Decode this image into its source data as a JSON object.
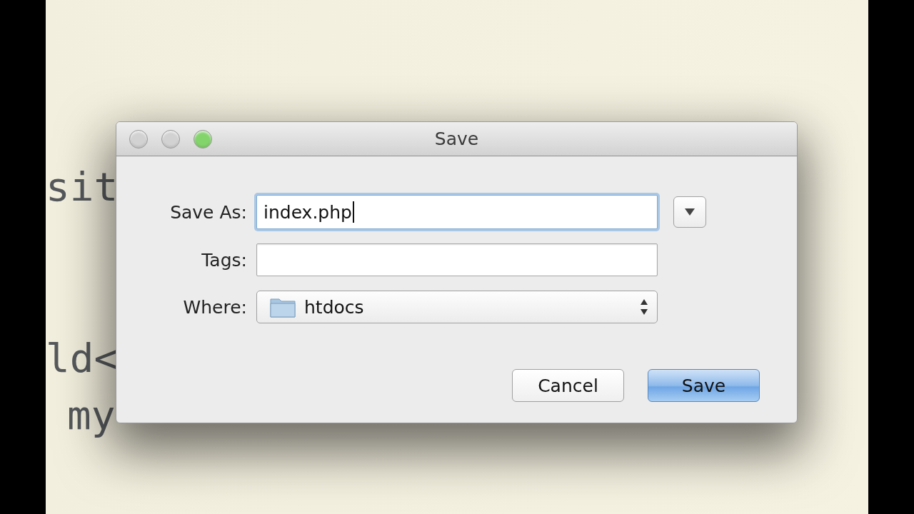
{
  "editor": {
    "code_lines": [
      {
        "text": "sit"
      },
      {
        "text": "ld<"
      },
      {
        "text": "my"
      }
    ]
  },
  "dialog": {
    "title": "Save",
    "window_buttons": [
      {
        "color": "#d2d2d2"
      },
      {
        "color": "#d2d2d2"
      },
      {
        "color": "#84d46c"
      }
    ],
    "fields": [
      {
        "kind": "text",
        "label": "Save As:",
        "value": "index.php",
        "focused": true
      },
      {
        "kind": "text",
        "label": "Tags:",
        "focused": false
      },
      {
        "kind": "popup",
        "label": "Where:",
        "value": "htdocs"
      }
    ],
    "expand_toggle": {
      "expanded": false
    },
    "buttons": [
      {
        "label": "Cancel",
        "default": false
      },
      {
        "label": "Save",
        "default": true
      }
    ]
  }
}
